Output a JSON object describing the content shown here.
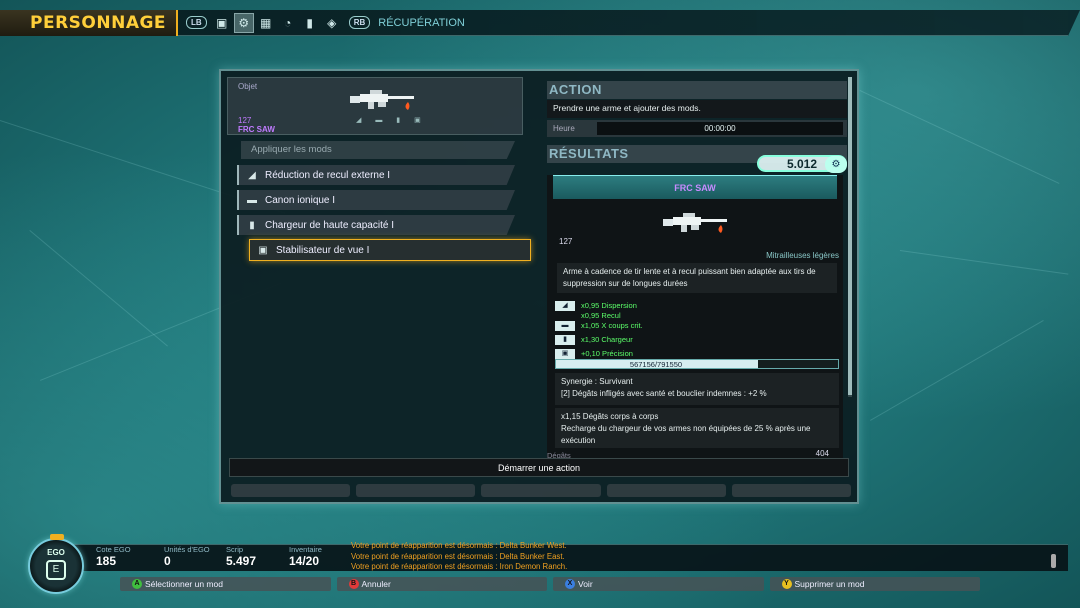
{
  "header": {
    "title": "PERSONNAGE",
    "lb_label": "LB",
    "rb_label": "RB",
    "section": "RÉCUPÉRATION",
    "nav_icons": [
      "inventory-icon",
      "briefcase-icon",
      "crafting-icon",
      "map-icon",
      "radar-icon",
      "stats-icon",
      "scrip-icon"
    ]
  },
  "object": {
    "label": "Objet",
    "level": "127",
    "name": "FRC SAW"
  },
  "mods": {
    "header": "Appliquer les mods",
    "items": [
      {
        "label": "Réduction de recul externe I",
        "icon": "stock-icon"
      },
      {
        "label": "Canon ionique I",
        "icon": "barrel-icon"
      },
      {
        "label": "Chargeur de haute capacité I",
        "icon": "magazine-icon"
      },
      {
        "label": "Stabilisateur de vue I",
        "icon": "scope-icon"
      }
    ],
    "selected_index": 3
  },
  "action": {
    "title": "ACTION",
    "description": "Prendre une arme et ajouter des mods.",
    "heure_label": "Heure",
    "heure_value": "00:00:00"
  },
  "results": {
    "title": "RÉSULTATS",
    "score": "5.012",
    "weapon_name": "FRC SAW",
    "level": "127",
    "type": "Mitrailleuses légères",
    "description": "Arme à cadence de tir lente et à recul puissant bien adaptée aux tirs de suppression sur de longues durées",
    "stats": [
      {
        "text": "x0,95 Dispersion",
        "icon": true
      },
      {
        "text": "x0,95 Recul",
        "icon": false
      },
      {
        "text": "x1,05 X coups crit.",
        "icon": true
      },
      {
        "text": "x1,30 Chargeur",
        "icon": true
      },
      {
        "text": "+0,10 Précision",
        "icon": true
      }
    ],
    "xp_text": "567156/791550",
    "xp_progress": 0.7165,
    "synergy_line1": "Synergie : Survivant",
    "synergy_line2": "[2] Dégâts infligés avec santé et bouclier indemnes : +2 %",
    "perk_line1": "x1,15 Dégâts corps à corps",
    "perk_line2": "Recharge du chargeur de vos armes non équipées de 25 % après une exécution",
    "degats_label": "Dégâts",
    "degats_value": "404"
  },
  "start_action": "Démarrer une action",
  "hud": {
    "ego_label": "EGO",
    "cote_label": "Cote EGO",
    "cote_value": "185",
    "units_label": "Unités d'EGO",
    "units_value": "0",
    "scrip_label": "Scrip",
    "scrip_value": "5.497",
    "inventory_label": "Inventaire",
    "inventory_value": "14/20",
    "messages": [
      "Votre point de réapparition est désormais : Delta Bunker West.",
      "Votre point de réapparition est désormais : Delta Bunker East.",
      "Votre point de réapparition est désormais : Iron Demon Ranch."
    ]
  },
  "prompts": [
    {
      "button": "A",
      "label": "Sélectionner un mod",
      "color": "#3fbf3f"
    },
    {
      "button": "B",
      "label": "Annuler",
      "color": "#e03a3a"
    },
    {
      "button": "X",
      "label": "Voir",
      "color": "#3a7fe0"
    },
    {
      "button": "Y",
      "label": "Supprimer un mod",
      "color": "#e8c020"
    }
  ],
  "colors": {
    "accent": "#f0b020",
    "rarity_purple": "#c07bff",
    "stat_green": "#5cff6a",
    "message_orange": "#f0a020"
  }
}
